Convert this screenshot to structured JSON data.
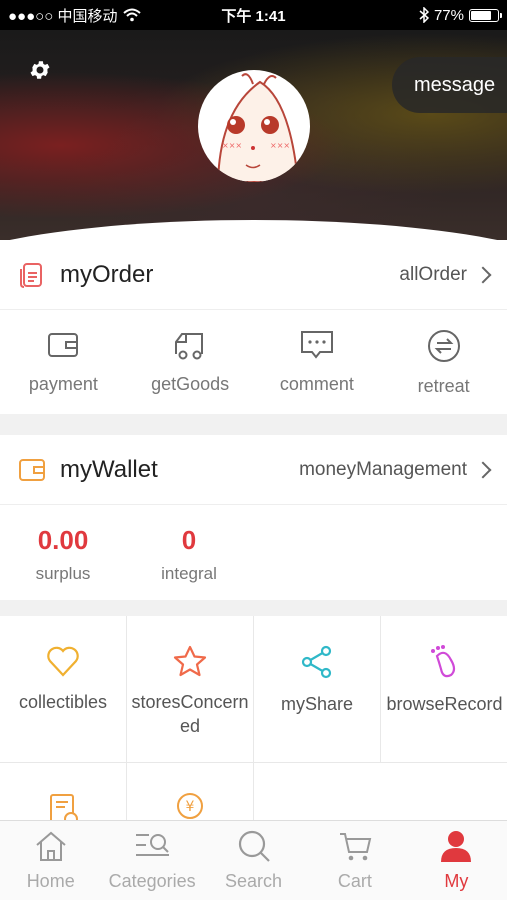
{
  "status_bar": {
    "carrier": "●●●○○ 中国移动",
    "time": "下午 1:41",
    "battery": "77%",
    "battery_level": 0.77
  },
  "header": {
    "message_label": "message"
  },
  "order": {
    "title": "myOrder",
    "link": "allOrder",
    "items": [
      {
        "label": "payment",
        "icon": "wallet-icon"
      },
      {
        "label": "getGoods",
        "icon": "truck-icon"
      },
      {
        "label": "comment",
        "icon": "comment-icon"
      },
      {
        "label": "retreat",
        "icon": "return-icon"
      }
    ]
  },
  "wallet": {
    "title": "myWallet",
    "link": "moneyManagement",
    "values": [
      {
        "value": "0.00",
        "label": "surplus"
      },
      {
        "value": "0",
        "label": "integral"
      }
    ]
  },
  "features": [
    {
      "label": "collectibles",
      "icon": "heart-icon"
    },
    {
      "label": "storesConcerned",
      "icon": "star-icon"
    },
    {
      "label": "myShare",
      "icon": "share-icon"
    },
    {
      "label": "browseRecord",
      "icon": "footprint-icon"
    },
    {
      "label": "",
      "icon": "checklist-icon"
    },
    {
      "label": "",
      "icon": "coin-icon"
    }
  ],
  "tabs": [
    {
      "label": "Home",
      "icon": "home-icon"
    },
    {
      "label": "Categories",
      "icon": "categories-icon"
    },
    {
      "label": "Search",
      "icon": "search-icon"
    },
    {
      "label": "Cart",
      "icon": "cart-icon"
    },
    {
      "label": "My",
      "icon": "user-icon",
      "active": true
    }
  ],
  "colors": {
    "accent": "#e0393e",
    "order_icon": "#e96363",
    "wallet_icon": "#f0a040",
    "heart": "#f0b030",
    "star": "#f06a4a",
    "share": "#2fb8c8",
    "browse": "#d04ad8"
  }
}
